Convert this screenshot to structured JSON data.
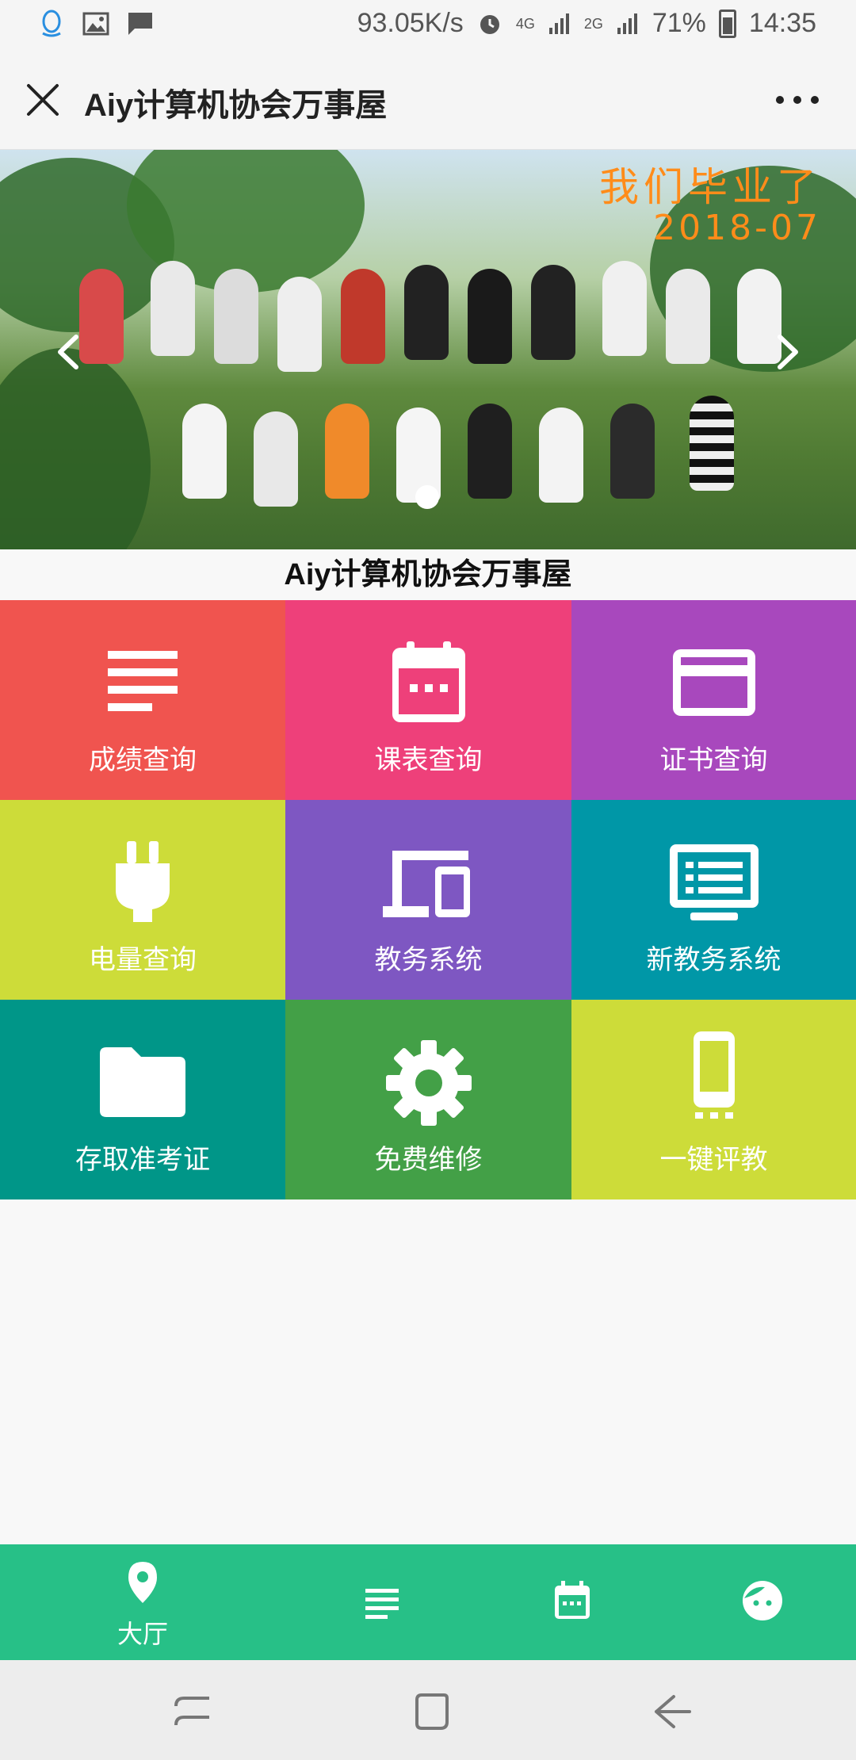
{
  "status_bar": {
    "speed": "93.05K/s",
    "network_4g": "4G",
    "network_2g": "2G",
    "battery": "71%",
    "time": "14:35"
  },
  "header": {
    "title": "Aiy计算机协会万事屋"
  },
  "banner": {
    "caption_line1": "我们毕业了",
    "caption_line2": "2018-07",
    "active_slide": 1
  },
  "subtitle": "Aiy计算机协会万事屋",
  "grid": {
    "tiles": [
      {
        "label": "成绩查询",
        "icon": "list-icon",
        "color": "#f0544f"
      },
      {
        "label": "课表查询",
        "icon": "calendar-icon",
        "color": "#ee407a"
      },
      {
        "label": "证书查询",
        "icon": "card-icon",
        "color": "#a848bd"
      },
      {
        "label": "电量查询",
        "icon": "plug-icon",
        "color": "#cddc39"
      },
      {
        "label": "教务系统",
        "icon": "devices-icon",
        "color": "#7e57c2"
      },
      {
        "label": "新教务系统",
        "icon": "monitor-icon",
        "color": "#0097a7"
      },
      {
        "label": "存取准考证",
        "icon": "folder-icon",
        "color": "#009688"
      },
      {
        "label": "免费维修",
        "icon": "gear-icon",
        "color": "#43a047"
      },
      {
        "label": "一键评教",
        "icon": "phone-icon",
        "color": "#cddc39"
      }
    ]
  },
  "bottom_nav": {
    "items": [
      {
        "label": "大厅",
        "icon": "location-pin-icon"
      },
      {
        "label": "",
        "icon": "list-icon"
      },
      {
        "label": "",
        "icon": "calendar-icon"
      },
      {
        "label": "",
        "icon": "face-icon"
      }
    ],
    "color": "#27c087"
  }
}
